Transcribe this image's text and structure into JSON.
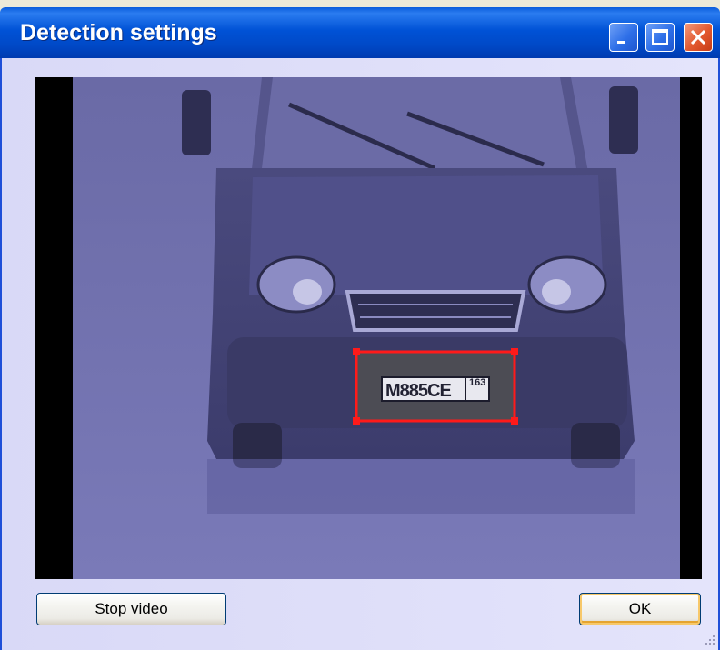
{
  "window": {
    "title": "Detection settings",
    "titlebar_color": "#0052d6",
    "close_color": "#e2582e"
  },
  "titlebar": {
    "minimize_icon": "minimize-icon",
    "maximize_icon": "maximize-icon",
    "close_icon": "close-icon"
  },
  "video": {
    "plate_number": "M885CE",
    "plate_region": "163",
    "detection_box_color": "#ff1a1a"
  },
  "buttons": {
    "stop_video_label": "Stop video",
    "ok_label": "OK"
  }
}
